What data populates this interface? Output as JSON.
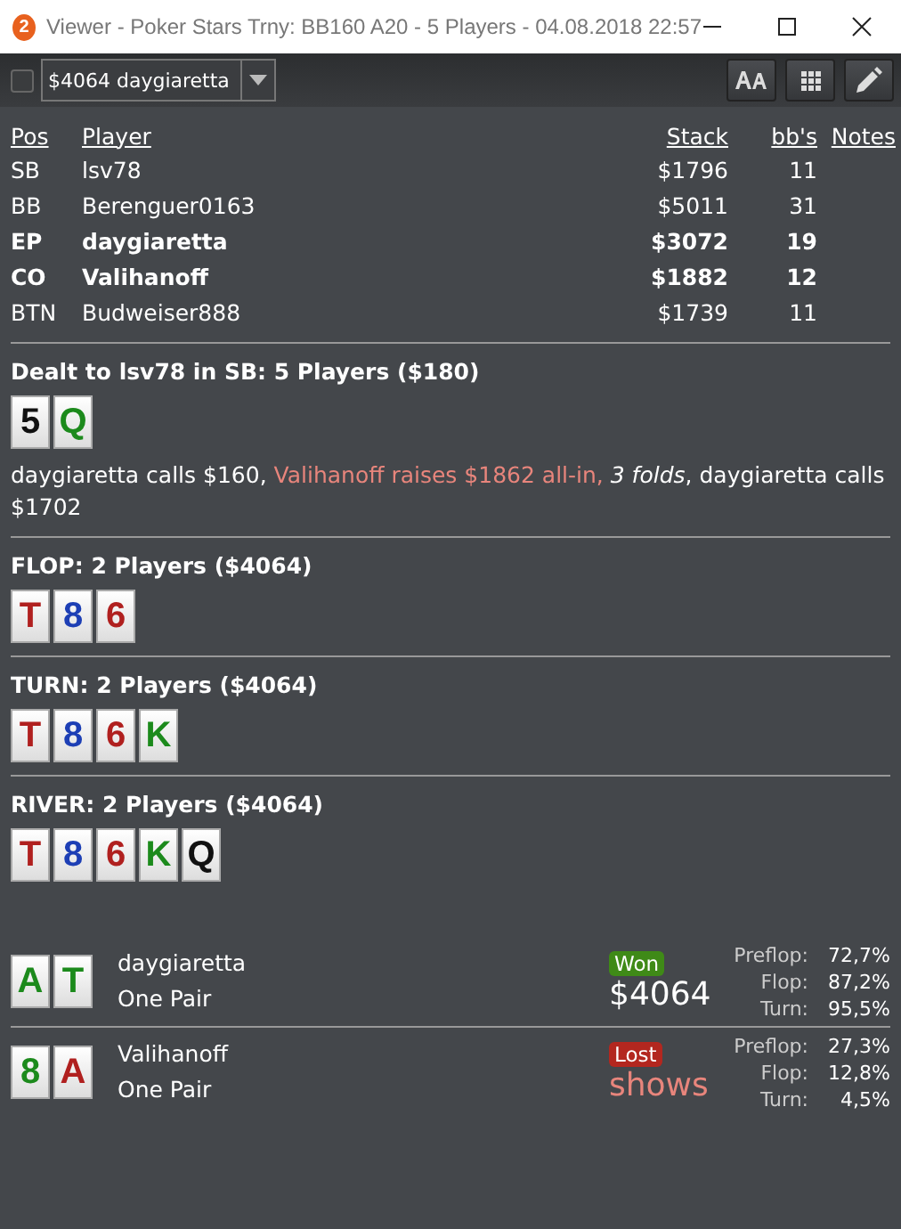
{
  "window": {
    "title": "Viewer - Poker Stars Trny: BB160 A20 - 5 Players - 04.08.2018 22:57",
    "app_badge": "2"
  },
  "toolbar": {
    "checked": false,
    "hand_select": "$4064 daygiaretta"
  },
  "players": {
    "columns": [
      "Pos",
      "Player",
      "Stack",
      "bb's",
      "Notes"
    ],
    "rows": [
      {
        "pos": "SB",
        "player": "lsv78",
        "stack": "$1796",
        "bbs": "11",
        "involved": false
      },
      {
        "pos": "BB",
        "player": "Berenguer0163",
        "stack": "$5011",
        "bbs": "31",
        "involved": false
      },
      {
        "pos": "EP",
        "player": "daygiaretta",
        "stack": "$3072",
        "bbs": "19",
        "involved": true
      },
      {
        "pos": "CO",
        "player": "Valihanoff",
        "stack": "$1882",
        "bbs": "12",
        "involved": true
      },
      {
        "pos": "BTN",
        "player": "Budweiser888",
        "stack": "$1739",
        "bbs": "11",
        "involved": false
      }
    ]
  },
  "streets": [
    {
      "title": "Dealt to lsv78 in SB: 5 Players ($180)",
      "cards": [
        {
          "rank": "5",
          "color": "#111111"
        },
        {
          "rank": "Q",
          "color": "#1c8a1c"
        }
      ],
      "actions": [
        {
          "kind": "normal",
          "text": "daygiaretta calls $160, "
        },
        {
          "kind": "raise",
          "text": "Valihanoff raises $1862 all-in, "
        },
        {
          "kind": "fold",
          "text": "3 folds"
        },
        {
          "kind": "normal",
          "text": ", daygiaretta calls $1702"
        }
      ]
    },
    {
      "title": "FLOP: 2 Players ($4064)",
      "cards": [
        {
          "rank": "T",
          "color": "#b0201f"
        },
        {
          "rank": "8",
          "color": "#1d3fb5"
        },
        {
          "rank": "6",
          "color": "#b0201f"
        }
      ]
    },
    {
      "title": "TURN: 2 Players ($4064)",
      "cards": [
        {
          "rank": "T",
          "color": "#b0201f"
        },
        {
          "rank": "8",
          "color": "#1d3fb5"
        },
        {
          "rank": "6",
          "color": "#b0201f"
        },
        {
          "rank": "K",
          "color": "#1c8a1c"
        }
      ]
    },
    {
      "title": "RIVER: 2 Players ($4064)",
      "cards": [
        {
          "rank": "T",
          "color": "#b0201f"
        },
        {
          "rank": "8",
          "color": "#1d3fb5"
        },
        {
          "rank": "6",
          "color": "#b0201f"
        },
        {
          "rank": "K",
          "color": "#1c8a1c"
        },
        {
          "rank": "Q",
          "color": "#111111"
        }
      ]
    }
  ],
  "results": [
    {
      "cards": [
        {
          "rank": "A",
          "color": "#1c8a1c"
        },
        {
          "rank": "T",
          "color": "#1c8a1c"
        }
      ],
      "player": "daygiaretta",
      "hand": "One Pair",
      "won": true,
      "badge": "Won",
      "amount": "$4064",
      "equity": [
        {
          "label": "Preflop:",
          "value": "72,7%"
        },
        {
          "label": "Flop:",
          "value": "87,2%"
        },
        {
          "label": "Turn:",
          "value": "95,5%"
        }
      ]
    },
    {
      "cards": [
        {
          "rank": "8",
          "color": "#1c8a1c"
        },
        {
          "rank": "A",
          "color": "#b0201f"
        }
      ],
      "player": "Valihanoff",
      "hand": "One Pair",
      "won": false,
      "badge": "Lost",
      "amount": "shows",
      "equity": [
        {
          "label": "Preflop:",
          "value": "27,3%"
        },
        {
          "label": "Flop:",
          "value": "12,8%"
        },
        {
          "label": "Turn:",
          "value": "4,5%"
        }
      ]
    }
  ]
}
